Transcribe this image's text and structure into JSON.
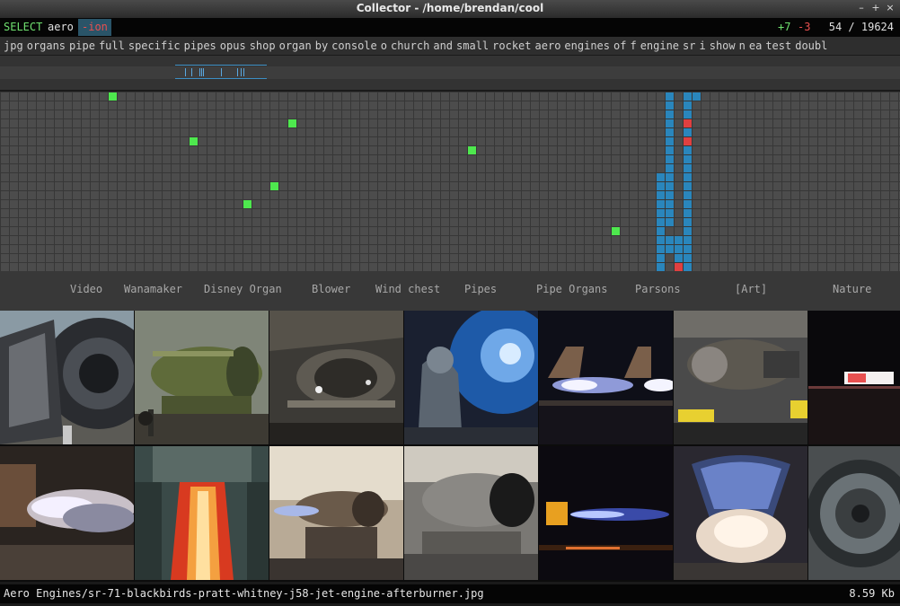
{
  "window": {
    "title": "Collector - /home/brendan/cool",
    "controls": [
      "–",
      "+",
      "×"
    ]
  },
  "query": {
    "keyword": "SELECT",
    "term": "aero",
    "exclude": "-ion",
    "added": "+7",
    "removed": "-3",
    "count": "54 / 19624"
  },
  "tags": [
    "jpg",
    "organs",
    "pipe",
    "full",
    "specific",
    "pipes",
    "opus",
    "shop",
    "organ",
    "by",
    "console",
    "o",
    "church",
    "and",
    "small",
    "rocket",
    "aero",
    "engines",
    "of",
    "f",
    "engine",
    "sr",
    "i",
    "show",
    "n",
    "ea",
    "test",
    "doubl"
  ],
  "albums": [
    "Video",
    "Wanamaker",
    "Disney Organ",
    "Blower",
    "Wind chest",
    "Pipes",
    "Pipe Organs",
    "Parsons",
    "[Art]",
    "Nature"
  ],
  "thumbnails": [
    {
      "id": "engine-nozzle-closeup-thumb"
    },
    {
      "id": "green-engine-test-stand-thumb"
    },
    {
      "id": "engine-in-hangar-dim-thumb"
    },
    {
      "id": "blue-engine-intake-thumb"
    },
    {
      "id": "night-afterburner-thumb"
    },
    {
      "id": "engine-test-cell-caution-thumb"
    },
    {
      "id": "night-runway-lights-thumb"
    },
    {
      "id": "engine-exhaust-plume-thumb"
    },
    {
      "id": "rocket-flame-test-thumb"
    },
    {
      "id": "engine-on-stand-thumb"
    },
    {
      "id": "engine-museum-display-thumb"
    },
    {
      "id": "dark-afterburner-test-thumb"
    },
    {
      "id": "rocket-nozzle-firing-thumb"
    },
    {
      "id": "engine-turbine-face-thumb"
    }
  ],
  "status": {
    "path": "Aero Engines/sr-71-blackbirds-pratt-whitney-j58-jet-engine-afterburner.jpg",
    "size": "8.59 Kb"
  },
  "colors": {
    "accent_green": "#4ee84e",
    "accent_blue": "#2a86bc",
    "accent_red": "#e04040",
    "selection_bg": "#2a5468"
  }
}
